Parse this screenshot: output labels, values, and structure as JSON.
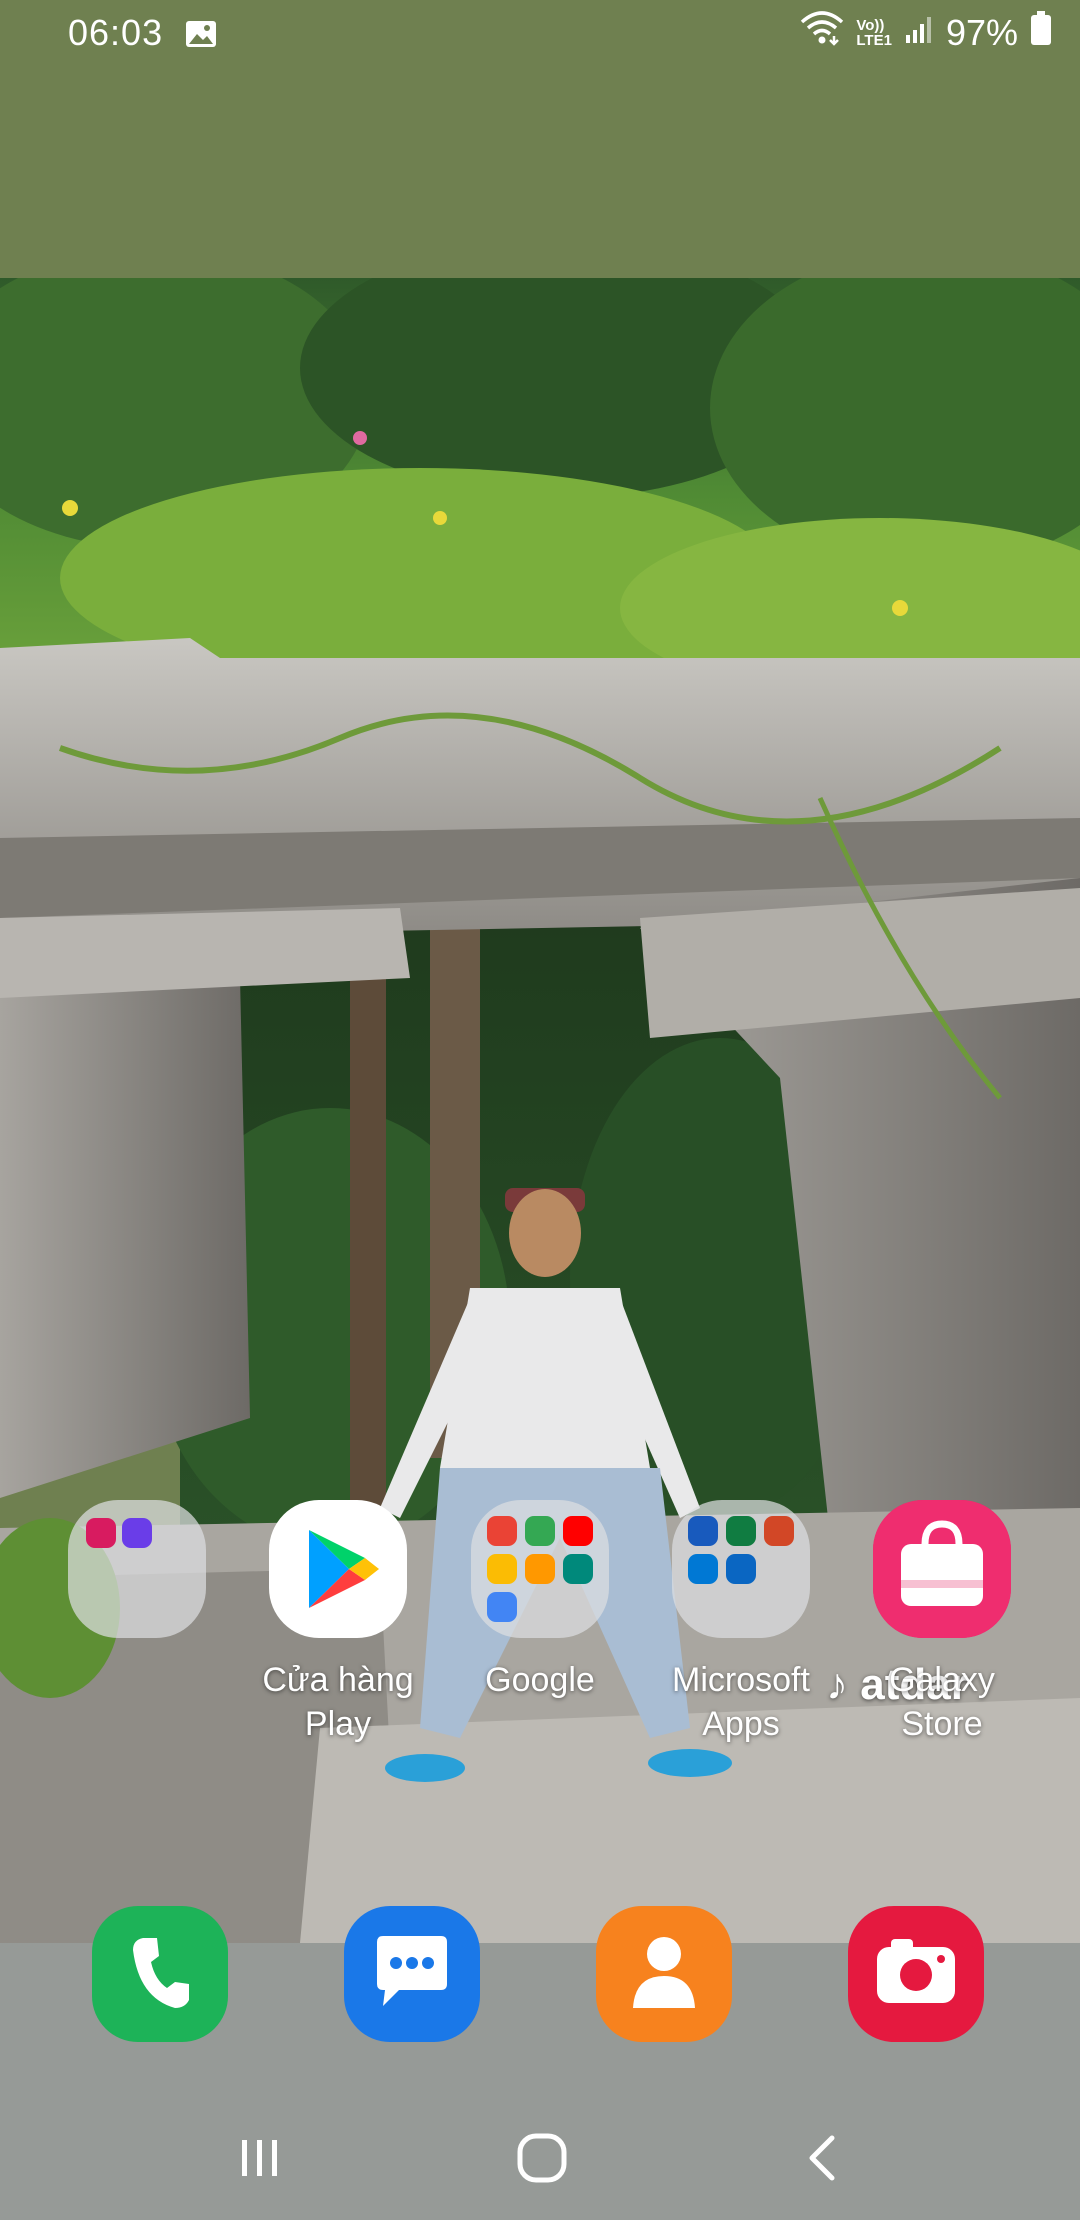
{
  "status_bar": {
    "time": "06:03",
    "gallery_icon": "image-icon",
    "network_label_top": "Vo))",
    "network_label_bottom": "LTE1",
    "battery": "97%"
  },
  "home": {
    "apps": [
      {
        "name": "folder-unnamed",
        "label": ""
      },
      {
        "name": "play-store",
        "label_line1": "Cửa hàng",
        "label_line2": "Play"
      },
      {
        "name": "google-folder",
        "label_line1": "Google",
        "label_line2": ""
      },
      {
        "name": "microsoft-folder",
        "label_line1": "Microsoft",
        "label_line2": "Apps"
      },
      {
        "name": "galaxy-store",
        "label_line1": "Galaxy",
        "label_line2": "Store"
      }
    ],
    "widget_text": "atdar"
  },
  "dock": {
    "apps": [
      "phone-icon",
      "messages-icon",
      "contacts-icon",
      "camera-icon"
    ]
  },
  "nav": {
    "recents": "recents-icon",
    "home": "home-icon",
    "back": "back-icon"
  },
  "colors": {
    "top_band": "#6f8050",
    "dock_bg": "#969a97",
    "phone": "#1db358",
    "messages": "#1a78e8",
    "contacts": "#f7821e",
    "camera": "#e5193f",
    "galaxy_store": "#e91e63"
  }
}
